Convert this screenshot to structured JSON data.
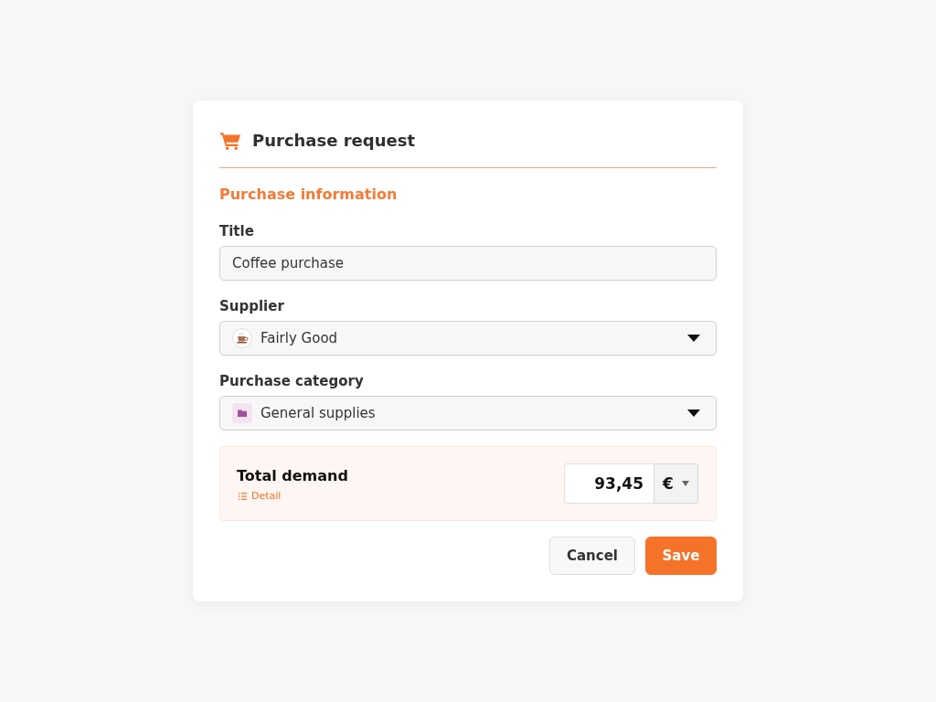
{
  "dialog": {
    "title": "Purchase request"
  },
  "section": {
    "heading": "Purchase information"
  },
  "fields": [
    {
      "kind": "text",
      "label": "Title",
      "value": "Coffee purchase"
    },
    {
      "kind": "supplier",
      "label": "Supplier",
      "value": "Fairly Good"
    },
    {
      "kind": "category",
      "label": "Purchase category",
      "value": "General supplies"
    }
  ],
  "total": {
    "label": "Total demand",
    "link": "Detail",
    "amount": "93,45",
    "currency": "€"
  },
  "buttons": [
    {
      "label": "Cancel",
      "kind": "secondary"
    },
    {
      "label": "Save",
      "kind": "primary"
    }
  ]
}
